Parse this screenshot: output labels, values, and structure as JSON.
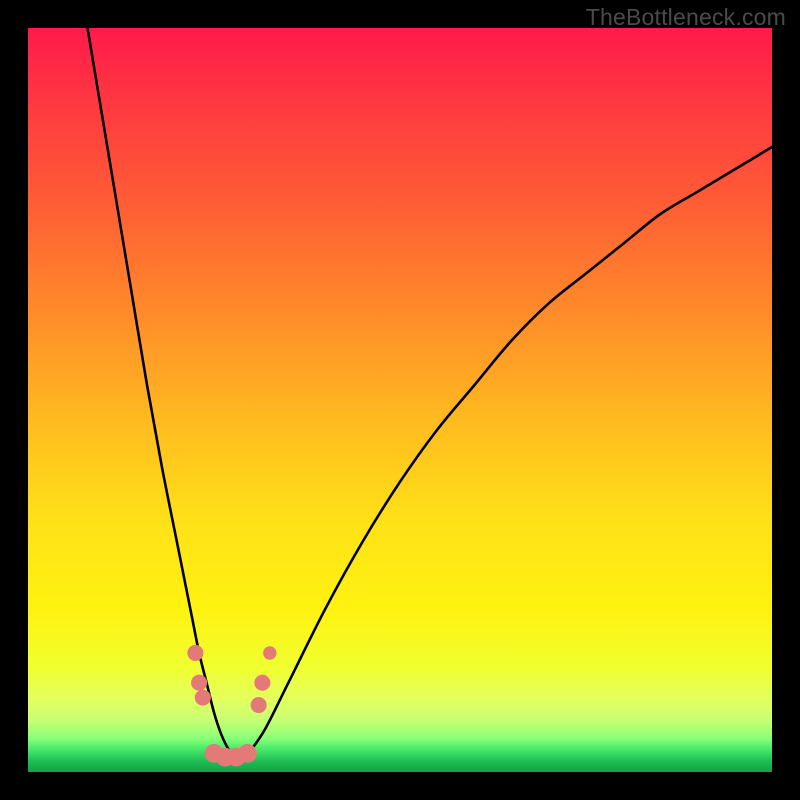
{
  "watermark": "TheBottleneck.com",
  "chart_data": {
    "type": "line",
    "title": "",
    "xlabel": "",
    "ylabel": "",
    "xlim": [
      0,
      100
    ],
    "ylim": [
      0,
      100
    ],
    "grid": false,
    "legend": false,
    "series": [
      {
        "name": "bottleneck-curve",
        "color": "#000000",
        "x": [
          8,
          10,
          12,
          14,
          16,
          18,
          20,
          22,
          23,
          24,
          25,
          26,
          27,
          28,
          29,
          30,
          32,
          35,
          40,
          45,
          50,
          55,
          60,
          65,
          70,
          75,
          80,
          85,
          90,
          95,
          100
        ],
        "y": [
          100,
          88,
          76,
          64,
          52,
          41,
          31,
          21,
          16,
          12,
          8,
          5,
          3,
          2,
          2,
          3,
          6,
          12,
          22,
          31,
          39,
          46,
          52,
          58,
          63,
          67,
          71,
          75,
          78,
          81,
          84
        ]
      }
    ],
    "markers": [
      {
        "name": "left-cluster-1",
        "x": 22.5,
        "y": 16,
        "r": 1.2,
        "color": "#e47a78"
      },
      {
        "name": "left-cluster-2",
        "x": 23.0,
        "y": 12,
        "r": 1.2,
        "color": "#e47a78"
      },
      {
        "name": "left-cluster-3",
        "x": 23.5,
        "y": 10,
        "r": 1.2,
        "color": "#e47a78"
      },
      {
        "name": "valley-1",
        "x": 25.0,
        "y": 2.5,
        "r": 1.4,
        "color": "#e47a78"
      },
      {
        "name": "valley-2",
        "x": 26.5,
        "y": 2.0,
        "r": 1.4,
        "color": "#e47a78"
      },
      {
        "name": "valley-3",
        "x": 28.0,
        "y": 2.0,
        "r": 1.4,
        "color": "#e47a78"
      },
      {
        "name": "valley-4",
        "x": 29.5,
        "y": 2.5,
        "r": 1.4,
        "color": "#e47a78"
      },
      {
        "name": "right-cluster-1",
        "x": 31.0,
        "y": 9,
        "r": 1.2,
        "color": "#e47a78"
      },
      {
        "name": "right-cluster-2",
        "x": 31.5,
        "y": 12,
        "r": 1.2,
        "color": "#e47a78"
      },
      {
        "name": "right-cluster-3",
        "x": 32.5,
        "y": 16,
        "r": 1.0,
        "color": "#e47a78"
      }
    ]
  }
}
